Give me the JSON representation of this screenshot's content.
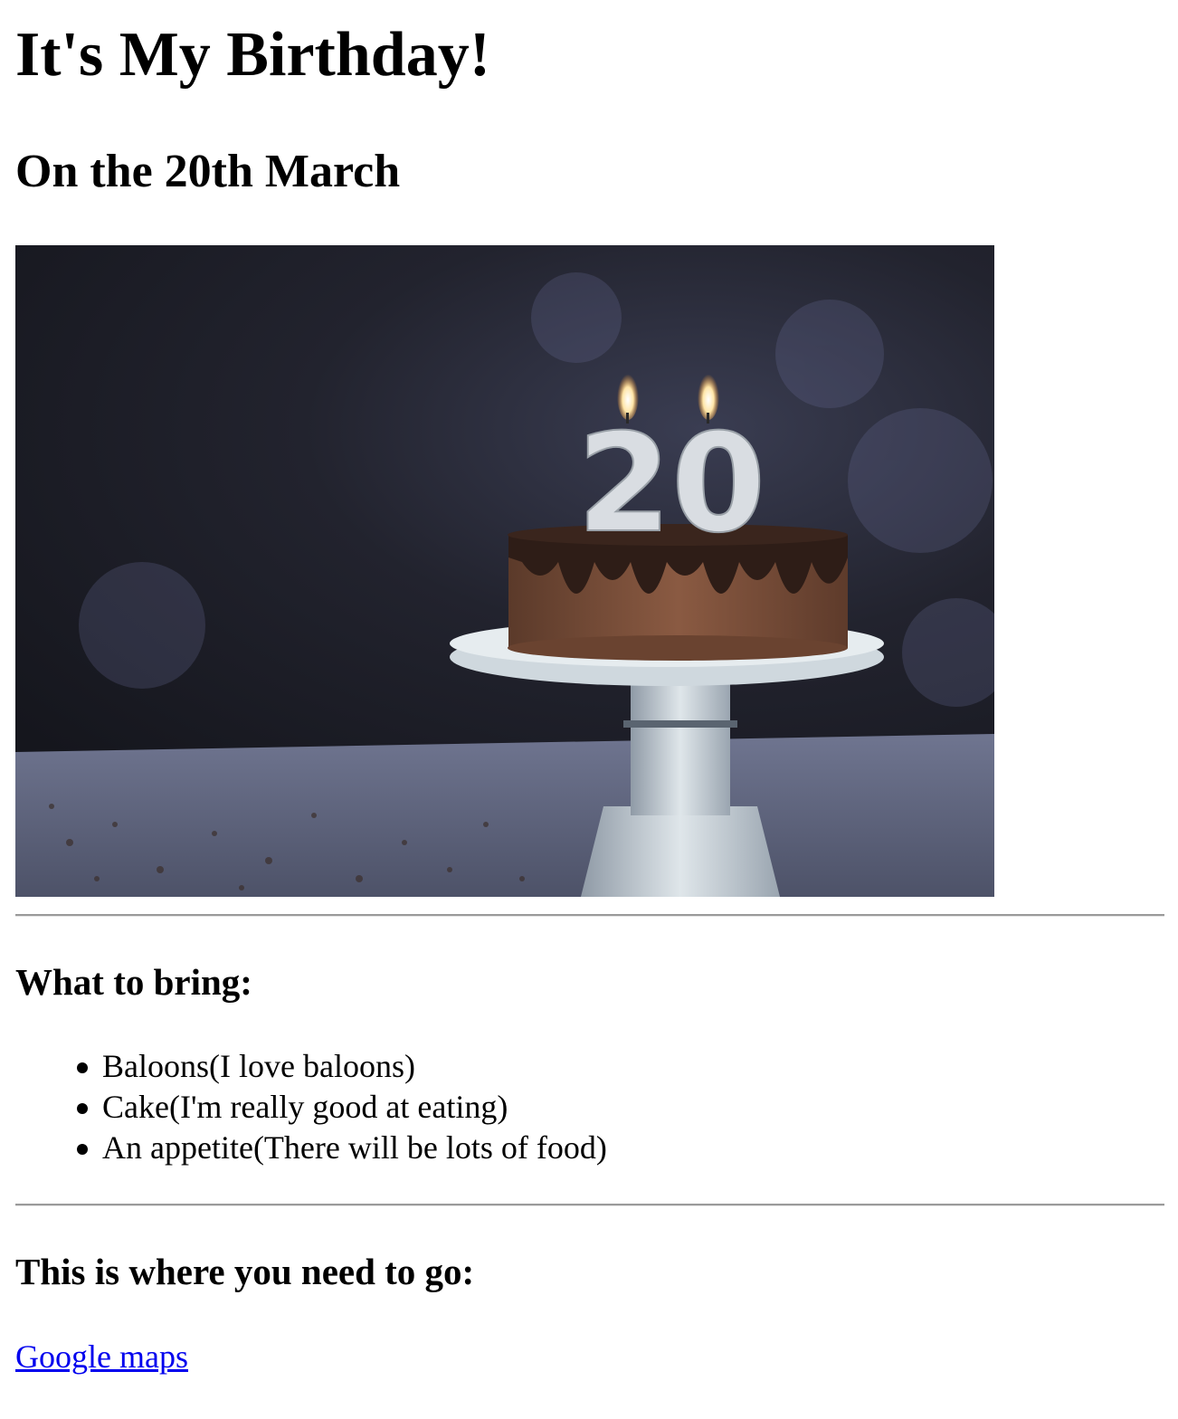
{
  "page": {
    "title": "It's My Birthday!",
    "subtitle": "On the 20th March"
  },
  "hero_image": {
    "description_icon": "birthday-cake-image",
    "candle_number": "20"
  },
  "bring_section": {
    "heading": "What to bring:",
    "items": [
      "Baloons(I love baloons)",
      "Cake(I'm really good at eating)",
      "An appetite(There will be lots of food)"
    ]
  },
  "location_section": {
    "heading": "This is where you need to go:",
    "link_label": "Google maps"
  },
  "colors": {
    "link": "#0000ee",
    "text": "#000000",
    "background": "#ffffff"
  }
}
